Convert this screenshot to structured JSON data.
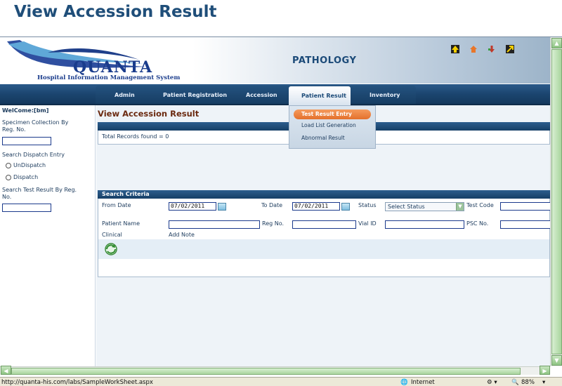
{
  "slide_title": "View Accession Result",
  "header": {
    "logo_name": "QUANTA",
    "logo_subtitle": "Hospital Information Management System",
    "app_title": "PATHOLOGY"
  },
  "nav": {
    "items": [
      "Admin",
      "Patient Registration",
      "Accession",
      "Patient Result",
      "Inventory"
    ],
    "active": "Patient Result"
  },
  "dropdown": {
    "items": [
      "Test Result Entry",
      "Load List Generation",
      "Abnormal Result"
    ],
    "highlighted": "Test Result Entry"
  },
  "sidebar": {
    "welcome": "WelCome:[bm]",
    "specimen_label": "Specimen Collection By Reg. No.",
    "dispatch_label": "Search Dispatch Entry",
    "undispatch": "UnDispatch",
    "dispatch": "Dispatch",
    "test_result_label": "Search Test Result By Reg. No."
  },
  "main": {
    "heading": "View Accession Result",
    "total_records": "Total Records found = 0",
    "search_criteria": "Search Criteria",
    "from_date_label": "From Date",
    "from_date_value": "07/02/2011",
    "to_date_label": "To Date",
    "to_date_value": "07/02/2011",
    "status_label": "Status",
    "status_value": "Select Status",
    "test_code_label": "Test Code",
    "patient_name_label": "Patient Name",
    "reg_no_label": "Reg No.",
    "vial_id_label": "Vial ID",
    "psc_no_label": "PSC No.",
    "clinical_label": "Clinical",
    "add_note_label": "Add Note"
  },
  "statusbar": {
    "url": "http://quanta-his.com/labs/SampleWorkSheet.aspx",
    "zone": "Internet",
    "zoom": "88%"
  },
  "colors": {
    "nav_blue": "#1b456f",
    "heading_brown": "#6b2a10",
    "dropdown_active": "#e4702c"
  }
}
